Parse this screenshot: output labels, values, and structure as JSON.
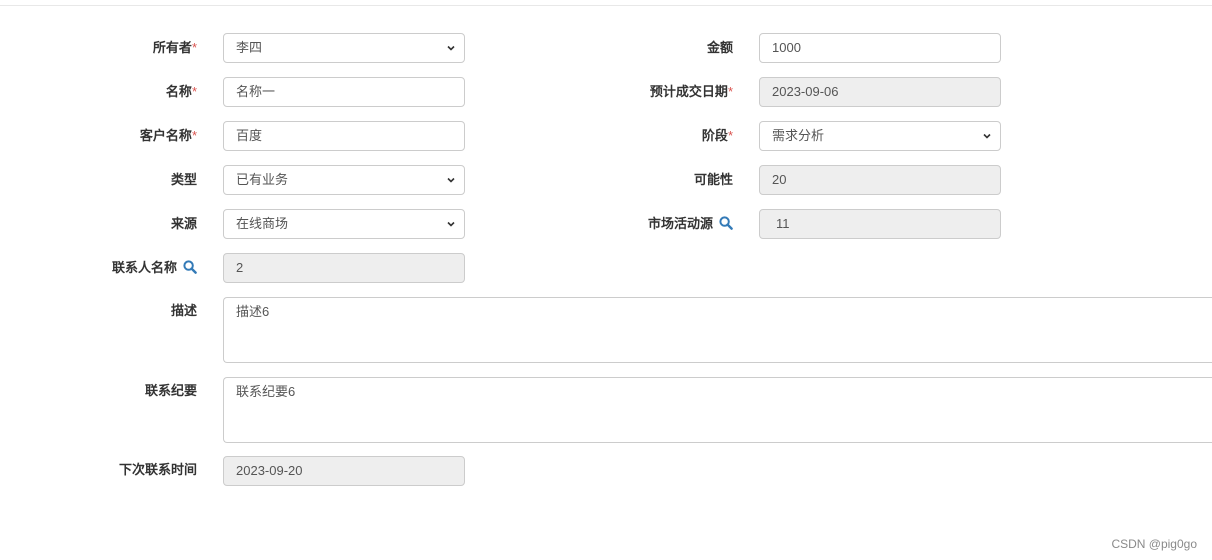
{
  "form": {
    "owner": {
      "label": "所有者",
      "required": "*",
      "value": "李四"
    },
    "amount": {
      "label": "金额",
      "value": "1000"
    },
    "name": {
      "label": "名称",
      "required": "*",
      "value": "名称一"
    },
    "close_date": {
      "label": "预计成交日期",
      "required": "*",
      "value": "2023-09-06"
    },
    "customer": {
      "label": "客户名称",
      "required": "*",
      "value": "百度"
    },
    "stage": {
      "label": "阶段",
      "required": "*",
      "value": "需求分析"
    },
    "type": {
      "label": "类型",
      "value": "已有业务"
    },
    "possibility": {
      "label": "可能性",
      "value": "20"
    },
    "source": {
      "label": "来源",
      "value": "在线商场"
    },
    "activity_source": {
      "label": "市场活动源",
      "value": "11"
    },
    "contact_name": {
      "label": "联系人名称",
      "value": "2"
    },
    "description": {
      "label": "描述",
      "value": "描述6"
    },
    "contact_summary": {
      "label": "联系纪要",
      "value": "联系纪要6"
    },
    "next_contact_time": {
      "label": "下次联系时间",
      "value": "2023-09-20"
    }
  },
  "watermark": "CSDN @pig0go"
}
